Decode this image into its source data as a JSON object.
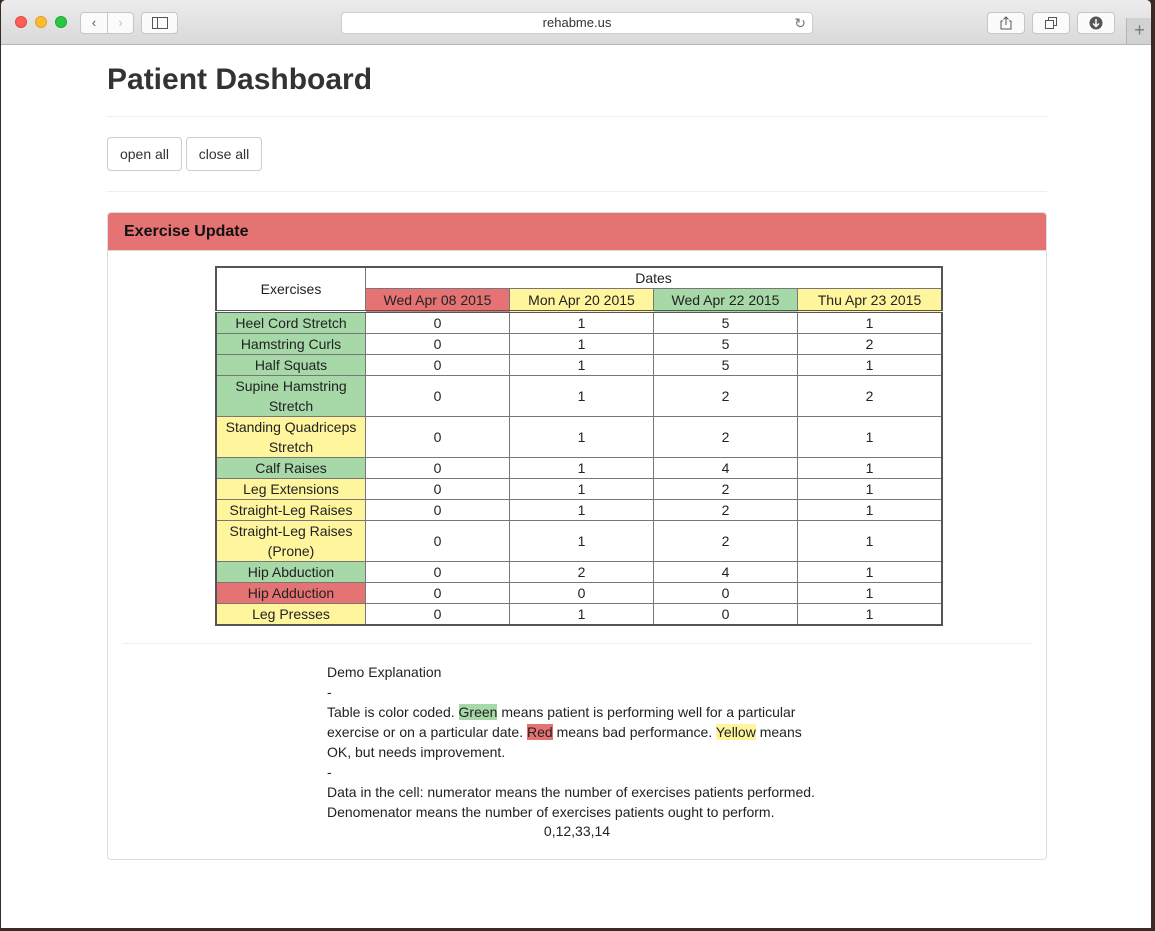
{
  "browser": {
    "url": "rehabme.us",
    "back_icon": "‹",
    "forward_icon": "›",
    "reload_icon": "↻",
    "new_tab_icon": "+"
  },
  "page": {
    "title": "Patient Dashboard",
    "open_all_label": "open all",
    "close_all_label": "close all"
  },
  "panel": {
    "title": "Exercise Update",
    "color": "#e57373"
  },
  "colors": {
    "green": "#a6d8a8",
    "red": "#e57373",
    "yellow": "#fff59d"
  },
  "table": {
    "exercises_header": "Exercises",
    "dates_header": "Dates",
    "dates": [
      {
        "label": "Wed Apr 08 2015",
        "status": "red"
      },
      {
        "label": "Mon Apr 20 2015",
        "status": "yellow"
      },
      {
        "label": "Wed Apr 22 2015",
        "status": "green"
      },
      {
        "label": "Thu Apr 23 2015",
        "status": "yellow"
      }
    ],
    "rows": [
      {
        "exercise": "Heel Cord Stretch",
        "status": "green",
        "values": [
          "0",
          "1",
          "5",
          "1"
        ]
      },
      {
        "exercise": "Hamstring Curls",
        "status": "green",
        "values": [
          "0",
          "1",
          "5",
          "2"
        ]
      },
      {
        "exercise": "Half Squats",
        "status": "green",
        "values": [
          "0",
          "1",
          "5",
          "1"
        ]
      },
      {
        "exercise": "Supine Hamstring Stretch",
        "status": "green",
        "values": [
          "0",
          "1",
          "2",
          "2"
        ]
      },
      {
        "exercise": "Standing Quadriceps Stretch",
        "status": "yellow",
        "values": [
          "0",
          "1",
          "2",
          "1"
        ]
      },
      {
        "exercise": "Calf Raises",
        "status": "green",
        "values": [
          "0",
          "1",
          "4",
          "1"
        ]
      },
      {
        "exercise": "Leg Extensions",
        "status": "yellow",
        "values": [
          "0",
          "1",
          "2",
          "1"
        ]
      },
      {
        "exercise": "Straight-Leg Raises",
        "status": "yellow",
        "values": [
          "0",
          "1",
          "2",
          "1"
        ]
      },
      {
        "exercise": "Straight-Leg Raises (Prone)",
        "status": "yellow",
        "values": [
          "0",
          "1",
          "2",
          "1"
        ]
      },
      {
        "exercise": "Hip Abduction",
        "status": "green",
        "values": [
          "0",
          "2",
          "4",
          "1"
        ]
      },
      {
        "exercise": "Hip Adduction",
        "status": "red",
        "values": [
          "0",
          "0",
          "0",
          "1"
        ]
      },
      {
        "exercise": "Leg Presses",
        "status": "yellow",
        "values": [
          "0",
          "1",
          "0",
          "1"
        ]
      }
    ]
  },
  "explanation": {
    "title": "Demo Explanation",
    "sep1": "-",
    "p1_start": "Table is color coded. ",
    "green_word": "Green",
    "p1_mid1": " means patient is performing well for a particular exercise or on a particular date. ",
    "red_word": "Red",
    "p1_mid2": " means bad performance. ",
    "yellow_word": "Yellow",
    "p1_end": " means OK, but needs improvement.",
    "sep2": "-",
    "p2": "Data in the cell: numerator means the number of exercises patients performed. Denomenator means the number of exercises patients ought to perform.",
    "ratios": "0,12,33,14"
  }
}
